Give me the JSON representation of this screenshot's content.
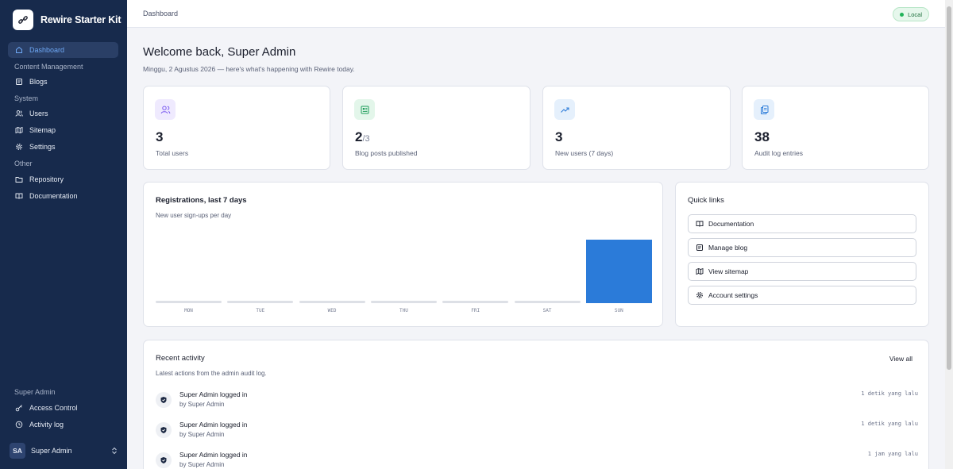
{
  "sidebar": {
    "brand": "Rewire Starter Kit",
    "items": [
      {
        "label": "Dashboard",
        "icon": "home-icon",
        "active": true
      },
      {
        "group": "Content Management"
      },
      {
        "label": "Blogs",
        "icon": "blog-icon"
      },
      {
        "group": "System"
      },
      {
        "label": "Users",
        "icon": "users-icon"
      },
      {
        "label": "Sitemap",
        "icon": "map-icon"
      },
      {
        "label": "Settings",
        "icon": "gear-icon"
      },
      {
        "group": "Other"
      },
      {
        "label": "Repository",
        "icon": "folder-icon"
      },
      {
        "label": "Documentation",
        "icon": "book-icon"
      }
    ],
    "footer_group": "Super Admin",
    "footer_items": [
      {
        "label": "Access Control",
        "icon": "key-icon"
      },
      {
        "label": "Activity log",
        "icon": "clock-icon"
      }
    ],
    "user": {
      "initials": "SA",
      "name": "Super Admin"
    }
  },
  "topbar": {
    "breadcrumb": "Dashboard",
    "env_badge": "Local"
  },
  "header": {
    "title": "Welcome back, Super Admin",
    "subtitle": "Minggu, 2 Agustus 2026 — here's what's happening with Rewire today."
  },
  "stats": [
    {
      "value": "3",
      "label": "Total users",
      "icon": "users-icon",
      "color": "#7c5cf0",
      "bg": "#efeafe"
    },
    {
      "value": "2",
      "fraction": "/3",
      "label": "Blog posts published",
      "icon": "newspaper-icon",
      "color": "#1e9e5a",
      "bg": "#e3f6ea"
    },
    {
      "value": "3",
      "label": "New users (7 days)",
      "icon": "trend-up-icon",
      "color": "#2b7bd9",
      "bg": "#e5f0fc"
    },
    {
      "value": "38",
      "label": "Audit log entries",
      "icon": "clipboard-icon",
      "color": "#2b7bd9",
      "bg": "#e5f0fc"
    }
  ],
  "registrations": {
    "title": "Registrations, last 7 days",
    "subtitle": "New user sign-ups per day"
  },
  "chart_data": {
    "type": "bar",
    "categories": [
      "MON",
      "TUE",
      "WED",
      "THU",
      "FRI",
      "SAT",
      "SUN"
    ],
    "values": [
      0,
      0,
      0,
      0,
      0,
      0,
      3
    ],
    "ylim": [
      0,
      3
    ],
    "accent": "#2b7bd9"
  },
  "quick_links": {
    "title": "Quick links",
    "items": [
      {
        "label": "Documentation",
        "icon": "book-icon"
      },
      {
        "label": "Manage blog",
        "icon": "blog-icon"
      },
      {
        "label": "View sitemap",
        "icon": "map-icon"
      },
      {
        "label": "Account settings",
        "icon": "gear-icon"
      }
    ]
  },
  "activity": {
    "title": "Recent activity",
    "subtitle": "Latest actions from the admin audit log.",
    "view_all": "View all",
    "rows": [
      {
        "title": "Super Admin logged in",
        "by": "by Super Admin",
        "time": "1 detik yang lalu"
      },
      {
        "title": "Super Admin logged in",
        "by": "by Super Admin",
        "time": "1 detik yang lalu"
      },
      {
        "title": "Super Admin logged in",
        "by": "by Super Admin",
        "time": "1 jam yang lalu"
      }
    ]
  }
}
